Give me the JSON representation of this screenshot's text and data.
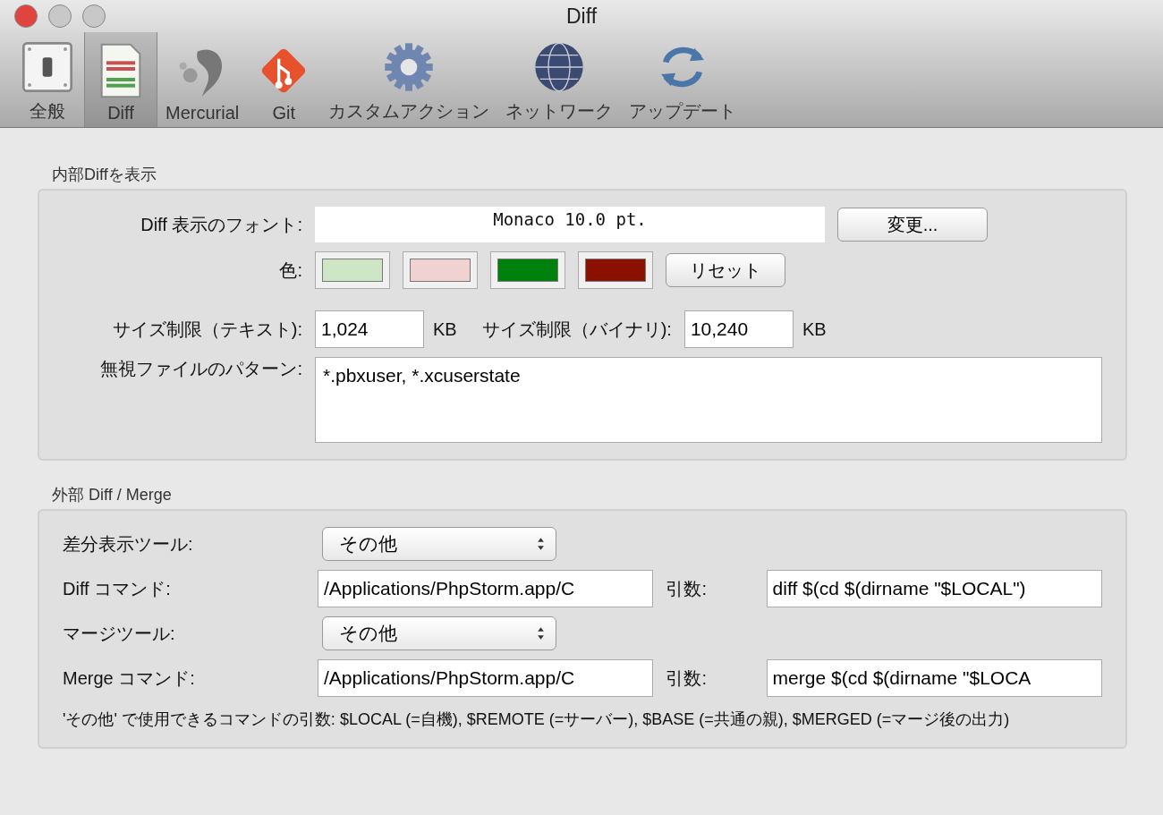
{
  "window": {
    "title": "Diff",
    "controls": [
      {
        "kind": "close"
      },
      {
        "kind": "minimize"
      },
      {
        "kind": "zoom"
      }
    ]
  },
  "toolbar": [
    {
      "label": "全般",
      "kind": "switch",
      "selected": false
    },
    {
      "label": "Diff",
      "kind": "document",
      "selected": true
    },
    {
      "label": "Mercurial",
      "kind": "mercurial",
      "selected": false
    },
    {
      "label": "Git",
      "kind": "git",
      "selected": false
    },
    {
      "label": "カスタムアクション",
      "kind": "gear",
      "selected": false
    },
    {
      "label": "ネットワーク",
      "kind": "globe",
      "selected": false
    },
    {
      "label": "アップデート",
      "kind": "sync",
      "selected": false
    }
  ],
  "internal": {
    "title": "内部Diffを表示",
    "font_label": "Diff 表示のフォント:",
    "font_value": "Monaco 10.0 pt.",
    "change_button": "変更...",
    "color_label": "色:",
    "colors": [
      {
        "color": "#cfe6c6"
      },
      {
        "color": "#f0d2d2"
      },
      {
        "color": "#00800d"
      },
      {
        "color": "#8c1000"
      }
    ],
    "reset_button": "リセット",
    "text_limit_label": "サイズ制限（テキスト):",
    "text_limit": "1,024",
    "text_unit": "KB",
    "binary_limit_label": "サイズ制限（バイナリ):",
    "binary_limit": "10,240",
    "binary_unit": "KB",
    "ignore_label": "無視ファイルのパターン:",
    "ignore_value": "*.pbxuser, *.xcuserstate"
  },
  "external": {
    "title": "外部 Diff / Merge",
    "rows": [
      {
        "kind": "select",
        "label": "差分表示ツール:",
        "value": "その他"
      },
      {
        "kind": "command",
        "label": "Diff コマンド:",
        "value": "/Applications/PhpStorm.app/C",
        "args_label": "引数:",
        "args_value": "diff $(cd $(dirname \"$LOCAL\")"
      },
      {
        "kind": "select",
        "label": "マージツール:",
        "value": "その他"
      },
      {
        "kind": "command",
        "label": "Merge コマンド:",
        "value": "/Applications/PhpStorm.app/C",
        "args_label": "引数:",
        "args_value": "merge $(cd $(dirname \"$LOCA"
      }
    ],
    "note": "'その他' で使用できるコマンドの引数: $LOCAL (=自機), $REMOTE (=サーバー), $BASE (=共通の親), $MERGED (=マージ後の出力)"
  }
}
